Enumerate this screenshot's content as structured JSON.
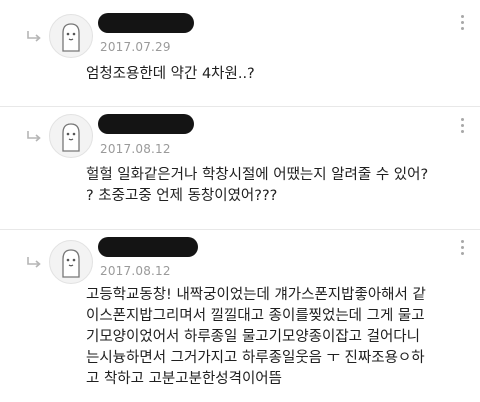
{
  "comments": [
    {
      "date": "2017.07.29",
      "lines": [
        "엄청조용한데 약간 4차원..?"
      ]
    },
    {
      "date": "2017.08.12",
      "lines": [
        "헐헐 일화같은거나 학창시절에 어땠는지 알려줄 수 있어?",
        "? 초중고중 언제 동창이였어???"
      ]
    },
    {
      "date": "2017.08.12",
      "lines": [
        "고등학교동창! 내짝궁이었는데 걔가스폰지밥좋아해서 같",
        "이스폰지밥그리며서 낄낄대고 종이를찢었는데 그게 물고",
        "기모양이었어서 하루종일 물고기모양종이잡고 걸어다니",
        "는시늉하면서 그거가지고 하루종일웃음 ㅜ 진짜조용ㅇ하",
        "고 착하고 고분고분한성격이어뜸"
      ]
    }
  ]
}
